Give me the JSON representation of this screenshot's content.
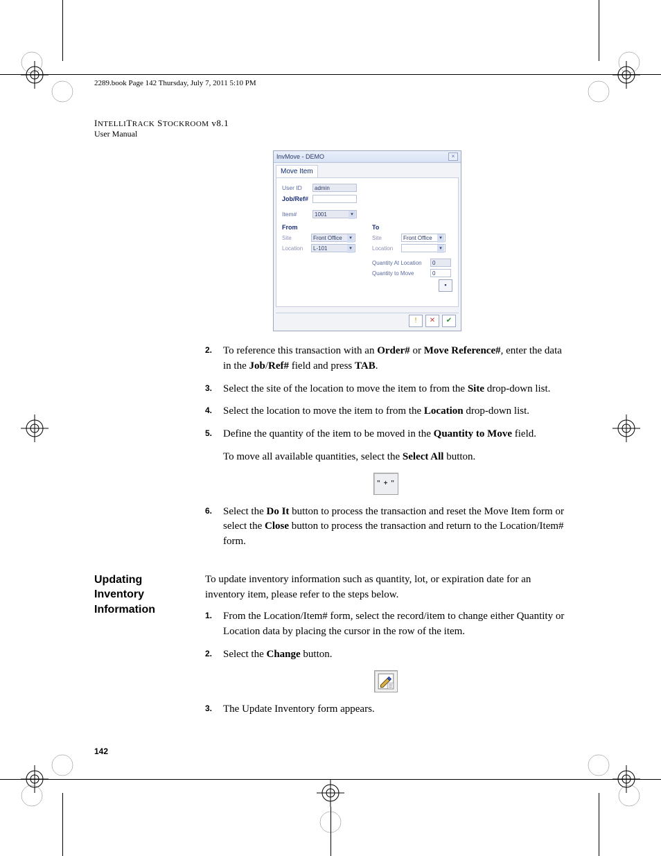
{
  "running_header": "2289.book  Page 142  Thursday, July 7, 2011  5:10 PM",
  "doc_title_1": "IntelliTrack Stockroom ",
  "doc_title_2": "v8.1",
  "doc_subtitle": "User Manual",
  "page_number": "142",
  "screenshot": {
    "window_title": "InvMove - DEMO",
    "tab": "Move Item",
    "user_id_lbl": "User ID",
    "user_id_val": "admin",
    "jobref_lbl": "Job/Ref#",
    "item_lbl": "Item#",
    "item_val": "1001",
    "from_lbl": "From",
    "to_lbl": "To",
    "site_lbl": "Site",
    "location_lbl": "Location",
    "from_site_val": "Front Office",
    "from_loc_val": "L-101",
    "to_site_val": "Front Office",
    "qty_at_loc_lbl": "Quantity At Location",
    "qty_at_loc_val": "0",
    "qty_to_move_lbl": "Quantity to Move",
    "qty_to_move_val": "0",
    "footer_icons": {
      "warn": "!",
      "close": "✕",
      "ok": "✔"
    }
  },
  "steps_a": {
    "n2": "2.",
    "t2_a": "To reference this transaction with an ",
    "t2_b1": "Order#",
    "t2_c": " or ",
    "t2_b2": "Move Reference#",
    "t2_d": ", enter the data in the ",
    "t2_b3": "Job",
    "t2_slash": "/",
    "t2_b4": "Ref#",
    "t2_e": " field and press ",
    "t2_b5": "TAB",
    "t2_f": ".",
    "n3": "3.",
    "t3_a": "Select the site of the location to move the item to from the ",
    "t3_b": "Site",
    "t3_c": " drop-down list.",
    "n4": "4.",
    "t4_a": "Select the location to move the item to from the ",
    "t4_b": "Location",
    "t4_c": " drop-down list.",
    "n5": "5.",
    "t5_a": "Define the quantity of the item to be moved in the ",
    "t5_b": "Quantity to Move",
    "t5_c": " field.",
    "p5_a": "To move all available quantities, select the ",
    "p5_b": "Select All",
    "p5_c": " button.",
    "n6": "6.",
    "t6_a": "Select the ",
    "t6_b1": "Do It",
    "t6_b": " button to process the transaction and reset the Move Item form or select the ",
    "t6_b2": "Close",
    "t6_c": " button to process the transaction and return to the Location/Item# form."
  },
  "section2": {
    "hdr1": "Updating",
    "hdr2": "Inventory",
    "hdr3": "Information",
    "intro": "To update inventory information such as quantity, lot, or expiration date for an inventory item, please refer to the steps below.",
    "n1": "1.",
    "t1": "From the Location/Item# form, select the record/item to change either Quantity or Location data by placing the cursor in the row of the item.",
    "n2": "2.",
    "t2_a": "Select the ",
    "t2_b": "Change",
    "t2_c": " button.",
    "n3": "3.",
    "t3": "The Update Inventory form appears."
  },
  "plus_label": "\" + \""
}
